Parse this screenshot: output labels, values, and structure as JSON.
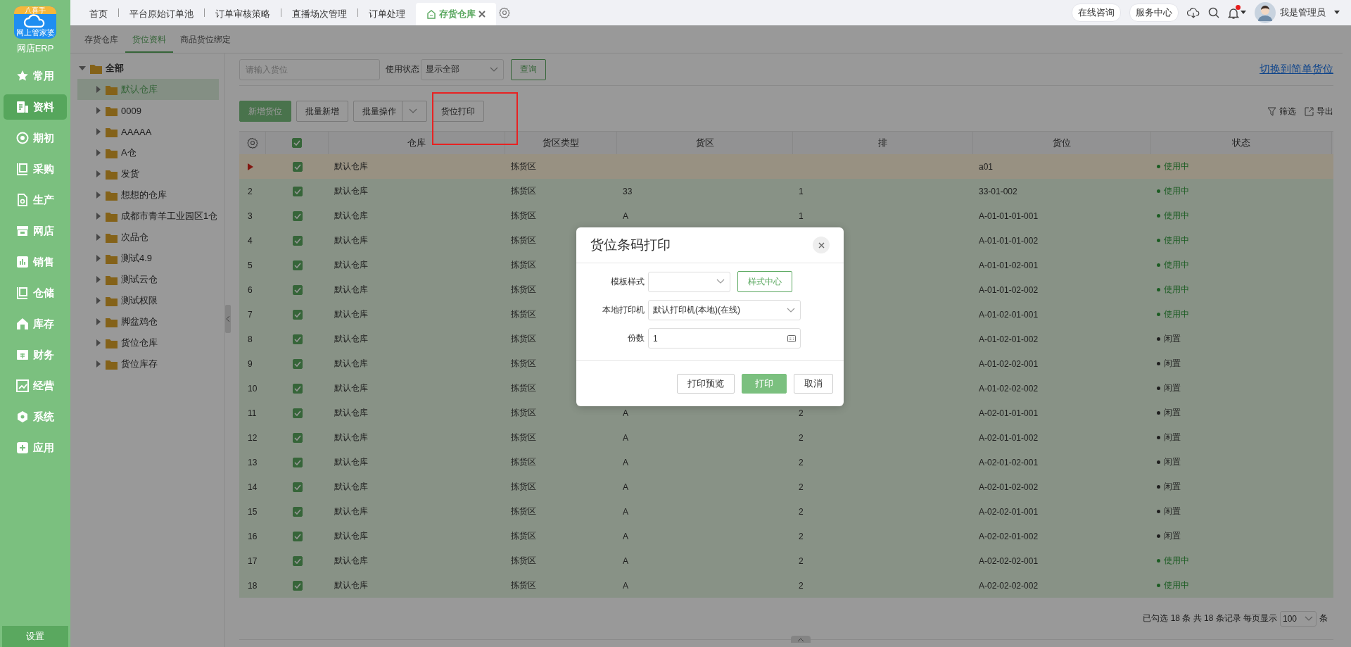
{
  "app": {
    "logo_badge": "八喜手",
    "logo_caption": "网上管家婆",
    "name": "网店ERP"
  },
  "sidebar": {
    "items": [
      {
        "label": "常用",
        "selected": false
      },
      {
        "label": "资料",
        "selected": true
      },
      {
        "label": "期初",
        "selected": false
      },
      {
        "label": "采购",
        "selected": false
      },
      {
        "label": "生产",
        "selected": false
      },
      {
        "label": "网店",
        "selected": false
      },
      {
        "label": "销售",
        "selected": false
      },
      {
        "label": "仓储",
        "selected": false
      },
      {
        "label": "库存",
        "selected": false
      },
      {
        "label": "财务",
        "selected": false
      },
      {
        "label": "经营",
        "selected": false
      },
      {
        "label": "系统",
        "selected": false
      },
      {
        "label": "应用",
        "selected": false
      }
    ],
    "settings": "设置"
  },
  "top_tabs": [
    {
      "label": "首页",
      "selected": false
    },
    {
      "label": "平台原始订单池",
      "selected": false
    },
    {
      "label": "订单审核策略",
      "selected": false
    },
    {
      "label": "直播场次管理",
      "selected": false
    },
    {
      "label": "订单处理",
      "selected": false
    },
    {
      "label": "存货仓库",
      "selected": true
    }
  ],
  "header": {
    "buttons": [
      "在线咨询",
      "服务中心"
    ],
    "has_unread": true,
    "user": "我是管理员"
  },
  "sub_tabs": [
    {
      "label": "存货仓库",
      "selected": false
    },
    {
      "label": "货位资料",
      "selected": true
    },
    {
      "label": "商品货位绑定",
      "selected": false
    }
  ],
  "tree": {
    "label": "全部",
    "expanded": true,
    "children": [
      {
        "label": "默认仓库",
        "selected": true
      },
      {
        "label": "0009",
        "selected": false
      },
      {
        "label": "AAAAA",
        "selected": false
      },
      {
        "label": "A仓",
        "selected": false
      },
      {
        "label": "发货",
        "selected": false
      },
      {
        "label": "想想的仓库",
        "selected": false
      },
      {
        "label": "成都市青羊工业园区1仓",
        "selected": false
      },
      {
        "label": "次品仓",
        "selected": false
      },
      {
        "label": "测试4.9",
        "selected": false
      },
      {
        "label": "测试云仓",
        "selected": false
      },
      {
        "label": "测试权限",
        "selected": false
      },
      {
        "label": "脚盆鸡仓",
        "selected": false
      },
      {
        "label": "货位仓库",
        "selected": false
      },
      {
        "label": "货位库存",
        "selected": false
      }
    ]
  },
  "filter": {
    "placeholder": "请输入货位",
    "status_label": "使用状态",
    "status_value": "显示全部",
    "query_button": "查询",
    "switch_link": "切换到简单货位"
  },
  "toolbar": {
    "buttons": [
      {
        "label": "新增货位",
        "kind": "primary"
      },
      {
        "label": "批量新增",
        "kind": "plain"
      },
      {
        "label": "批量操作",
        "kind": "dropdown"
      },
      {
        "label": "货位打印",
        "kind": "plain"
      }
    ],
    "filter": "筛选",
    "export": "导出"
  },
  "table": {
    "all_checked": true,
    "columns": [
      "仓库",
      "货区类型",
      "货区",
      "排",
      "货位",
      "状态"
    ],
    "rows": [
      {
        "selected": true,
        "checked": true,
        "warehouse": "默认仓库",
        "zone_type": "拣货区",
        "location": "a01",
        "status": {
          "text": "使用中",
          "kind": "in_use"
        }
      },
      {
        "index": "2",
        "selected": false,
        "checked": true,
        "warehouse": "默认仓库",
        "zone_type": "拣货区",
        "zone": "33",
        "row": "1",
        "location": "33-01-002",
        "status": {
          "text": "使用中",
          "kind": "in_use"
        }
      },
      {
        "index": "3",
        "selected": false,
        "checked": true,
        "warehouse": "默认仓库",
        "zone_type": "拣货区",
        "zone": "A",
        "row": "1",
        "location": "A-01-01-01-001",
        "status": {
          "text": "使用中",
          "kind": "in_use"
        }
      },
      {
        "index": "4",
        "selected": false,
        "checked": true,
        "warehouse": "默认仓库",
        "zone_type": "拣货区",
        "location": "A-01-01-01-002",
        "status": {
          "text": "使用中",
          "kind": "in_use"
        }
      },
      {
        "index": "5",
        "selected": false,
        "checked": true,
        "warehouse": "默认仓库",
        "zone_type": "拣货区",
        "location": "A-01-01-02-001",
        "status": {
          "text": "使用中",
          "kind": "in_use"
        }
      },
      {
        "index": "6",
        "selected": false,
        "checked": true,
        "warehouse": "默认仓库",
        "zone_type": "拣货区",
        "location": "A-01-01-02-002",
        "status": {
          "text": "使用中",
          "kind": "in_use"
        }
      },
      {
        "index": "7",
        "selected": false,
        "checked": true,
        "warehouse": "默认仓库",
        "zone_type": "拣货区",
        "location": "A-01-02-01-001",
        "status": {
          "text": "使用中",
          "kind": "in_use"
        }
      },
      {
        "index": "8",
        "selected": false,
        "checked": true,
        "warehouse": "默认仓库",
        "zone_type": "拣货区",
        "location": "A-01-02-01-002",
        "status": {
          "text": "闲置",
          "kind": "idle"
        }
      },
      {
        "index": "9",
        "selected": false,
        "checked": true,
        "warehouse": "默认仓库",
        "zone_type": "拣货区",
        "location": "A-01-02-02-001",
        "status": {
          "text": "闲置",
          "kind": "idle"
        }
      },
      {
        "index": "10",
        "selected": false,
        "checked": true,
        "warehouse": "默认仓库",
        "zone_type": "拣货区",
        "location": "A-01-02-02-002",
        "status": {
          "text": "闲置",
          "kind": "idle"
        }
      },
      {
        "index": "11",
        "selected": false,
        "checked": true,
        "warehouse": "默认仓库",
        "zone_type": "拣货区",
        "zone": "A",
        "row": "2",
        "location": "A-02-01-01-001",
        "status": {
          "text": "闲置",
          "kind": "idle"
        }
      },
      {
        "index": "12",
        "selected": false,
        "checked": true,
        "warehouse": "默认仓库",
        "zone_type": "拣货区",
        "zone": "A",
        "row": "2",
        "location": "A-02-01-01-002",
        "status": {
          "text": "闲置",
          "kind": "idle"
        }
      },
      {
        "index": "13",
        "selected": false,
        "checked": true,
        "warehouse": "默认仓库",
        "zone_type": "拣货区",
        "zone": "A",
        "row": "2",
        "location": "A-02-01-02-001",
        "status": {
          "text": "闲置",
          "kind": "idle"
        }
      },
      {
        "index": "14",
        "selected": false,
        "checked": true,
        "warehouse": "默认仓库",
        "zone_type": "拣货区",
        "zone": "A",
        "row": "2",
        "location": "A-02-01-02-002",
        "status": {
          "text": "闲置",
          "kind": "idle"
        }
      },
      {
        "index": "15",
        "selected": false,
        "checked": true,
        "warehouse": "默认仓库",
        "zone_type": "拣货区",
        "zone": "A",
        "row": "2",
        "location": "A-02-02-01-001",
        "status": {
          "text": "闲置",
          "kind": "idle"
        }
      },
      {
        "index": "16",
        "selected": false,
        "checked": true,
        "warehouse": "默认仓库",
        "zone_type": "拣货区",
        "zone": "A",
        "row": "2",
        "location": "A-02-02-01-002",
        "status": {
          "text": "闲置",
          "kind": "idle"
        }
      },
      {
        "index": "17",
        "selected": false,
        "checked": true,
        "warehouse": "默认仓库",
        "zone_type": "拣货区",
        "zone": "A",
        "row": "2",
        "location": "A-02-02-02-001",
        "status": {
          "text": "使用中",
          "kind": "in_use"
        }
      },
      {
        "index": "18",
        "selected": false,
        "checked": true,
        "warehouse": "默认仓库",
        "zone_type": "拣货区",
        "zone": "A",
        "row": "2",
        "location": "A-02-02-02-002",
        "status": {
          "text": "使用中",
          "kind": "in_use"
        }
      }
    ]
  },
  "pager": {
    "summary": "已勾选 18 条 共 18 条记录 每页显示",
    "page_size": "100",
    "unit": "条"
  },
  "dialog": {
    "title": "货位条码打印",
    "fields": [
      {
        "label": "模板样式",
        "kind": "select"
      },
      {
        "label": "本地打印机",
        "kind": "select",
        "value": "默认打印机(本地)(在线)"
      },
      {
        "label": "份数",
        "kind": "number",
        "value": "1"
      }
    ],
    "style_button": "样式中心",
    "buttons": [
      {
        "label": "打印预览",
        "kind": "plain"
      },
      {
        "label": "打印",
        "kind": "primary"
      },
      {
        "label": "取消",
        "kind": "plain"
      }
    ]
  }
}
